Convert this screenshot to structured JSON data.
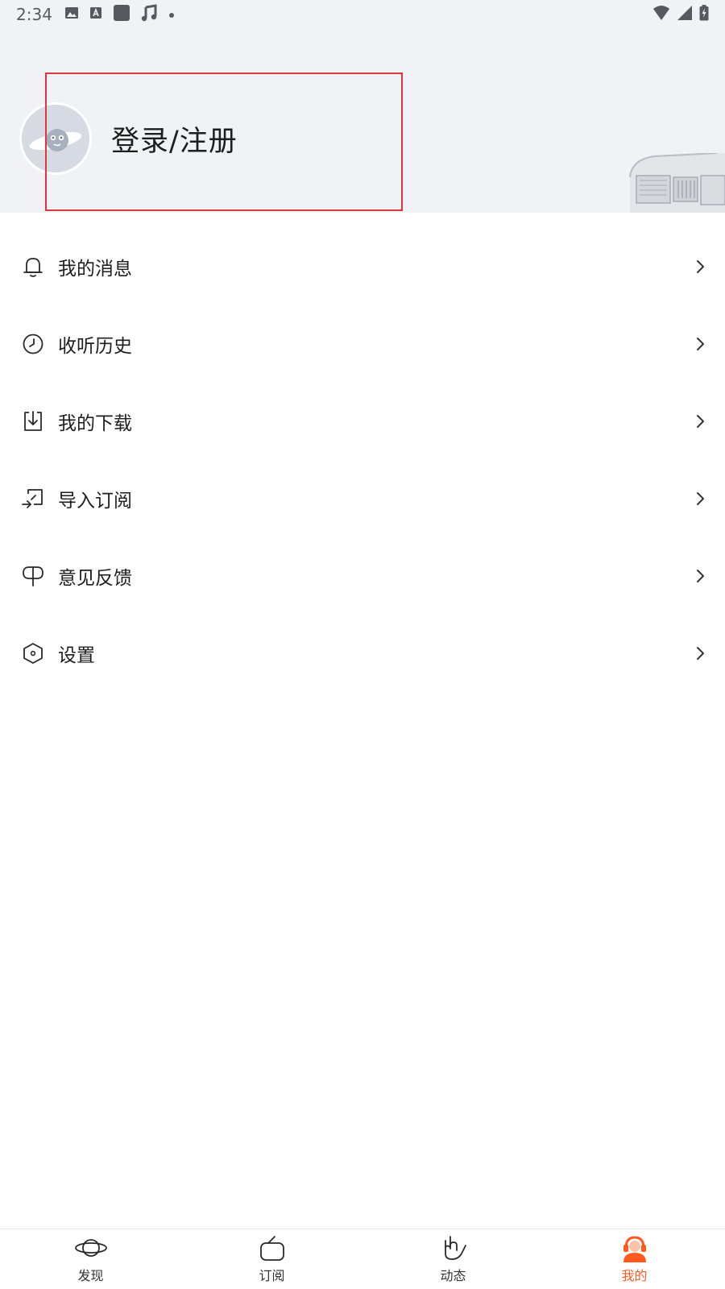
{
  "status_bar": {
    "time": "2:34",
    "left_icons": [
      "image-icon",
      "font-a-icon",
      "square-icon",
      "music-note-icon",
      "dot-icon"
    ],
    "right_icons": [
      "wifi-icon",
      "signal-icon",
      "battery-charging-icon"
    ]
  },
  "header": {
    "login_label": "登录/注册",
    "avatar_icon": "planet-face-avatar",
    "decoration_icon": "vintage-radio"
  },
  "menu": {
    "items": [
      {
        "label": "我的消息",
        "icon": "bell-icon"
      },
      {
        "label": "收听历史",
        "icon": "clock-icon"
      },
      {
        "label": "我的下载",
        "icon": "download-icon"
      },
      {
        "label": "导入订阅",
        "icon": "import-icon"
      },
      {
        "label": "意见反馈",
        "icon": "feedback-icon"
      },
      {
        "label": "设置",
        "icon": "settings-hexagon-icon"
      }
    ]
  },
  "bottom_nav": {
    "tabs": [
      {
        "label": "发现",
        "icon": "planet-icon",
        "active": false
      },
      {
        "label": "订阅",
        "icon": "tv-icon",
        "active": false
      },
      {
        "label": "动态",
        "icon": "hand-icon",
        "active": false
      },
      {
        "label": "我的",
        "icon": "user-headphones-icon",
        "active": true
      }
    ]
  },
  "colors": {
    "accent": "#ff5a1f",
    "header_bg": "#f1f2f6",
    "highlight_border": "#e0353d"
  }
}
